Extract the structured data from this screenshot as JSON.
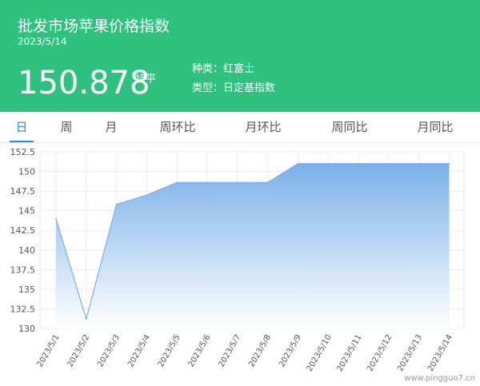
{
  "header": {
    "title": "批发市场苹果价格指数",
    "date": "2023/5/14",
    "price": "150.878",
    "trend": "持平",
    "variety_label": "种类：",
    "variety_value": "红富士",
    "type_label": "类型：",
    "type_value": "日定基指数",
    "bg_color": "#2ec27e"
  },
  "tabs": [
    {
      "label": "日",
      "active": true
    },
    {
      "label": "周",
      "active": false
    },
    {
      "label": "月",
      "active": false
    },
    {
      "label": "周环比",
      "active": false
    },
    {
      "label": "月环比",
      "active": false
    },
    {
      "label": "周同比",
      "active": false
    },
    {
      "label": "月同比",
      "active": false
    }
  ],
  "chart_data": {
    "type": "area",
    "x": [
      "2023/5/1",
      "2023/5/2",
      "2023/5/3",
      "2023/5/4",
      "2023/5/5",
      "2023/5/6",
      "2023/5/7",
      "2023/5/8",
      "2023/5/9",
      "2023/5/10",
      "2023/5/11",
      "2023/5/12",
      "2023/5/13",
      "2023/5/14"
    ],
    "series": [
      {
        "values": [
          144,
          131.2,
          145.8,
          147,
          148.6,
          148.6,
          148.6,
          148.6,
          151,
          151,
          151,
          151,
          151,
          151
        ]
      }
    ],
    "yticks": [
      "130",
      "132.5",
      "135",
      "137.5",
      "140",
      "142.5",
      "145",
      "147.5",
      "150",
      "152.5"
    ],
    "ylim": [
      130,
      152.5
    ],
    "grid": true,
    "line_color": "#7ab0e8",
    "fill_top_color": "#7ab0e8",
    "fill_bottom_color": "#ffffff"
  },
  "watermark": "www.pingguo7.cn"
}
